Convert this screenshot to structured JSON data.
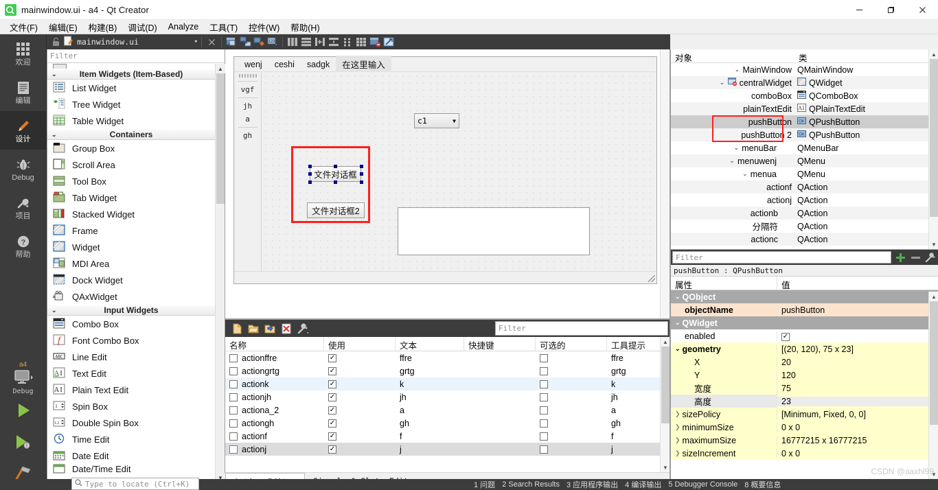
{
  "window": {
    "title": "mainwindow.ui - a4 - Qt Creator",
    "logo_text": "Qt",
    "minimize": "–",
    "maximize": "❐",
    "close": "✕"
  },
  "menubar": [
    {
      "label": "文件(F)"
    },
    {
      "label": "编辑(E)"
    },
    {
      "label": "构建(B)"
    },
    {
      "label": "调试(D)"
    },
    {
      "label": "Analyze"
    },
    {
      "label": "工具(T)"
    },
    {
      "label": "控件(W)"
    },
    {
      "label": "帮助(H)"
    }
  ],
  "modebar": {
    "items": [
      {
        "label": "欢迎",
        "icon": "grid-icon"
      },
      {
        "label": "编辑",
        "icon": "document-icon"
      },
      {
        "label": "设计",
        "icon": "pencil-icon"
      },
      {
        "label": "Debug",
        "icon": "bug-icon"
      },
      {
        "label": "项目",
        "icon": "wrench-icon"
      },
      {
        "label": "帮助",
        "icon": "question-icon"
      }
    ],
    "kit_name": "a4",
    "kit_config": "Debug",
    "run_label": "run-icon",
    "debug_label": "debug-icon",
    "build_label": "build-icon"
  },
  "editor_toolbar": {
    "lock_icon": "unlock-icon",
    "file_name": "mainwindow.ui",
    "dropdown": "▾",
    "close": "✕",
    "tools": [
      "edit-widgets-icon",
      "edit-signals-slots-icon",
      "edit-buddies-icon",
      "edit-tab-order-icon",
      "layout-horizontal-icon",
      "layout-vertical-icon",
      "layout-splitter-h-icon",
      "layout-splitter-v-icon",
      "layout-form-icon",
      "layout-grid-icon",
      "break-layout-icon",
      "adjust-size-icon"
    ]
  },
  "widget_box": {
    "filter_placeholder": "Filter",
    "groups": [
      {
        "title": "Item Widgets (Item-Based)",
        "items": [
          {
            "label": "List Widget",
            "icon": "list-widget-icon"
          },
          {
            "label": "Tree Widget",
            "icon": "tree-widget-icon"
          },
          {
            "label": "Table Widget",
            "icon": "table-widget-icon"
          }
        ]
      },
      {
        "title": "Containers",
        "items": [
          {
            "label": "Group Box",
            "icon": "group-box-icon"
          },
          {
            "label": "Scroll Area",
            "icon": "scroll-area-icon"
          },
          {
            "label": "Tool Box",
            "icon": "tool-box-icon"
          },
          {
            "label": "Tab Widget",
            "icon": "tab-widget-icon"
          },
          {
            "label": "Stacked Widget",
            "icon": "stacked-widget-icon"
          },
          {
            "label": "Frame",
            "icon": "frame-icon"
          },
          {
            "label": "Widget",
            "icon": "widget-icon"
          },
          {
            "label": "MDI Area",
            "icon": "mdi-area-icon"
          },
          {
            "label": "Dock Widget",
            "icon": "dock-widget-icon"
          },
          {
            "label": "QAxWidget",
            "icon": "qax-widget-icon"
          }
        ]
      },
      {
        "title": "Input Widgets",
        "items": [
          {
            "label": "Combo Box",
            "icon": "combo-box-icon"
          },
          {
            "label": "Font Combo Box",
            "icon": "font-combo-box-icon"
          },
          {
            "label": "Line Edit",
            "icon": "line-edit-icon"
          },
          {
            "label": "Text Edit",
            "icon": "text-edit-icon"
          },
          {
            "label": "Plain Text Edit",
            "icon": "plain-text-edit-icon"
          },
          {
            "label": "Spin Box",
            "icon": "spin-box-icon"
          },
          {
            "label": "Double Spin Box",
            "icon": "double-spin-box-icon"
          },
          {
            "label": "Time Edit",
            "icon": "time-edit-icon"
          },
          {
            "label": "Date Edit",
            "icon": "date-edit-icon"
          },
          {
            "label": "Date/Time Edit",
            "icon": "date-time-edit-icon"
          }
        ]
      }
    ]
  },
  "form": {
    "menus": [
      "wenj",
      "ceshi",
      "sadgk"
    ],
    "menu_placeholder": "在这里输入",
    "toolbar_actions": [
      "vgf",
      "jh",
      "a",
      "gh"
    ],
    "combo_value": "c1",
    "button1_text": "文件对话框",
    "button2_text": "文件对话框2"
  },
  "action_editor": {
    "filter_placeholder": "Filter",
    "toolbar_icons": [
      "new-action-icon",
      "open-icon",
      "copy-icon",
      "delete-icon",
      "configure-icon"
    ],
    "columns": [
      "名称",
      "使用",
      "文本",
      "快捷键",
      "可选的",
      "工具提示"
    ],
    "rows": [
      {
        "name": "actionffre",
        "used": true,
        "text": "ffre",
        "shortcut": "",
        "checkable": false,
        "tooltip": "ffre",
        "state": ""
      },
      {
        "name": "actiongrtg",
        "used": true,
        "text": "grtg",
        "shortcut": "",
        "checkable": false,
        "tooltip": "grtg",
        "state": ""
      },
      {
        "name": "actionk",
        "used": true,
        "text": "k",
        "shortcut": "",
        "checkable": false,
        "tooltip": "k",
        "state": "sel"
      },
      {
        "name": "actionjh",
        "used": true,
        "text": "jh",
        "shortcut": "",
        "checkable": false,
        "tooltip": "jh",
        "state": ""
      },
      {
        "name": "actiona_2",
        "used": true,
        "text": "a",
        "shortcut": "",
        "checkable": false,
        "tooltip": "a",
        "state": ""
      },
      {
        "name": "actiongh",
        "used": true,
        "text": "gh",
        "shortcut": "",
        "checkable": false,
        "tooltip": "gh",
        "state": ""
      },
      {
        "name": "actionf",
        "used": true,
        "text": "f",
        "shortcut": "",
        "checkable": false,
        "tooltip": "f",
        "state": ""
      },
      {
        "name": "actionj",
        "used": true,
        "text": "j",
        "shortcut": "",
        "checkable": false,
        "tooltip": "j",
        "state": "sel2"
      }
    ],
    "tabs": [
      {
        "label": "Action Editor",
        "active": true
      },
      {
        "label": "Signals & Slots Editor",
        "active": false
      }
    ]
  },
  "object_tree": {
    "columns": [
      "对象",
      "类"
    ],
    "rows": [
      {
        "name": "MainWindow",
        "cls": "QMainWindow",
        "depth": 0,
        "chev": "v",
        "icon": "",
        "state": ""
      },
      {
        "name": "centralWidget",
        "cls": "QWidget",
        "depth": 1,
        "chev": "v",
        "icon": "central-widget-icon",
        "state": "alt"
      },
      {
        "name": "comboBox",
        "cls": "QComboBox",
        "depth": 2,
        "chev": "",
        "icon": "combo-box-icon",
        "state": ""
      },
      {
        "name": "plainTextEdit",
        "cls": "QPlainTextEdit",
        "depth": 2,
        "chev": "",
        "icon": "plain-text-edit-icon",
        "state": "alt"
      },
      {
        "name": "pushButton",
        "cls": "QPushButton",
        "depth": 2,
        "chev": "",
        "icon": "push-button-icon",
        "state": "sel"
      },
      {
        "name": "pushButton 2",
        "cls": "QPushButton",
        "depth": 2,
        "chev": "",
        "icon": "push-button-icon",
        "state": "alt"
      },
      {
        "name": "menuBar",
        "cls": "QMenuBar",
        "depth": 1,
        "chev": "v",
        "icon": "",
        "state": ""
      },
      {
        "name": "menuwenj",
        "cls": "QMenu",
        "depth": 2,
        "chev": "v",
        "icon": "",
        "state": "alt"
      },
      {
        "name": "menua",
        "cls": "QMenu",
        "depth": 3,
        "chev": "v",
        "icon": "",
        "state": ""
      },
      {
        "name": "actionf",
        "cls": "QAction",
        "depth": 4,
        "chev": "",
        "icon": "",
        "state": "alt"
      },
      {
        "name": "actionj",
        "cls": "QAction",
        "depth": 4,
        "chev": "",
        "icon": "",
        "state": ""
      },
      {
        "name": "actionb",
        "cls": "QAction",
        "depth": 3,
        "chev": "",
        "icon": "",
        "state": "alt"
      },
      {
        "name": "分隔符",
        "cls": "QAction",
        "depth": 3,
        "chev": "",
        "icon": "",
        "state": ""
      },
      {
        "name": "actionc",
        "cls": "QAction",
        "depth": 3,
        "chev": "",
        "icon": "",
        "state": "alt"
      }
    ]
  },
  "property_editor": {
    "filter_placeholder": "Filter",
    "add_icon": "plus-icon",
    "remove_icon": "minus-icon",
    "config_icon": "configure-icon",
    "object_line": "pushButton : QPushButton",
    "columns": [
      "属性",
      "值"
    ],
    "rows": [
      {
        "key": "QObject",
        "value": "",
        "kind": "group",
        "chev": "v",
        "indent": 0
      },
      {
        "key": "objectName",
        "value": "pushButton",
        "kind": "peach",
        "chev": "",
        "indent": 1,
        "bold": true
      },
      {
        "key": "QWidget",
        "value": "",
        "kind": "group",
        "chev": "v",
        "indent": 0
      },
      {
        "key": "enabled",
        "value": "checkbox",
        "kind": "plain",
        "chev": "",
        "indent": 1
      },
      {
        "key": "geometry",
        "value": "[(20, 120), 75 x 23]",
        "kind": "yellow",
        "chev": "v",
        "indent": 0,
        "bold": true
      },
      {
        "key": "X",
        "value": "20",
        "kind": "yellow",
        "chev": "",
        "indent": 2
      },
      {
        "key": "Y",
        "value": "120",
        "kind": "yellow",
        "chev": "",
        "indent": 2
      },
      {
        "key": "宽度",
        "value": "75",
        "kind": "yellow",
        "chev": "",
        "indent": 2
      },
      {
        "key": "高度",
        "value": "23",
        "kind": "gray",
        "chev": "",
        "indent": 2
      },
      {
        "key": "sizePolicy",
        "value": "[Minimum, Fixed, 0, 0]",
        "kind": "yellow",
        "chev": ">",
        "indent": 0
      },
      {
        "key": "minimumSize",
        "value": "0 x 0",
        "kind": "yellow",
        "chev": ">",
        "indent": 0
      },
      {
        "key": "maximumSize",
        "value": "16777215 x 16777215",
        "kind": "yellow",
        "chev": ">",
        "indent": 0
      },
      {
        "key": "sizeIncrement",
        "value": "0 x 0",
        "kind": "yellow",
        "chev": ">",
        "indent": 0
      }
    ]
  },
  "locator": {
    "placeholder": "Type to locate (Ctrl+K)",
    "icon": "search-icon"
  },
  "statusbar": {
    "items": [
      "1 问题",
      "2 Search Results",
      "3 应用程序输出",
      "4 编译输出",
      "5 Debugger Console",
      "8 概要信息"
    ]
  },
  "watermark": "CSDN @aaxhl99",
  "colors": {
    "accent_red": "#ff1f1f",
    "selection": "#cdcdcd",
    "dark_chrome": "#3c3c3c",
    "qt_green": "#41cd52",
    "property_yellow": "#ffffcb",
    "property_peach": "#fbe3cd"
  }
}
